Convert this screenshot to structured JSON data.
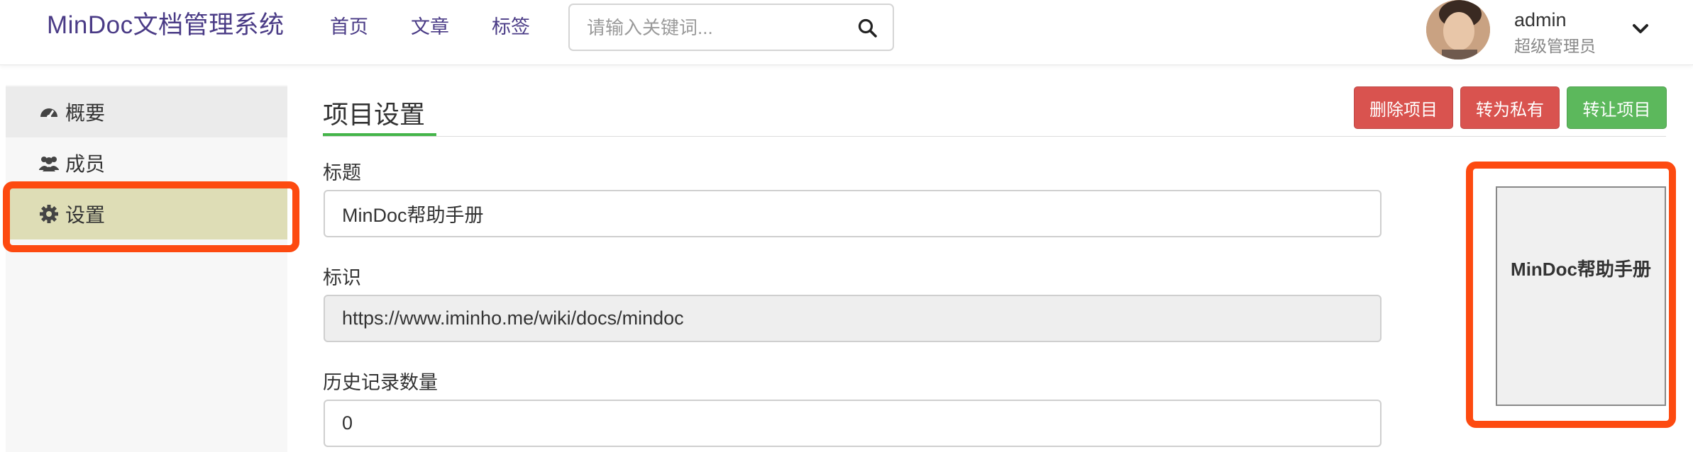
{
  "header": {
    "brand": "MinDoc文档管理系统",
    "nav": [
      "首页",
      "文章",
      "标签"
    ],
    "search_placeholder": "请输入关键词...",
    "user_name": "admin",
    "user_role": "超级管理员"
  },
  "sidebar": {
    "items": [
      {
        "label": "概要",
        "icon": "dashboard-icon"
      },
      {
        "label": "成员",
        "icon": "users-icon"
      },
      {
        "label": "设置",
        "icon": "gear-icon",
        "active": true
      }
    ]
  },
  "main": {
    "title": "项目设置",
    "buttons": {
      "delete": "删除项目",
      "private": "转为私有",
      "transfer": "转让项目"
    },
    "fields": {
      "title_label": "标题",
      "title_value": "MinDoc帮助手册",
      "ident_label": "标识",
      "ident_value": "https://www.iminho.me/wiki/docs/mindoc",
      "history_label": "历史记录数量",
      "history_value": "0"
    },
    "cover_text": "MinDoc帮助手册"
  },
  "colors": {
    "brand": "#4a3b86",
    "danger": "#d9534f",
    "success": "#5cb85c",
    "highlight": "#fd4a10",
    "active_item": "#deddb6"
  }
}
